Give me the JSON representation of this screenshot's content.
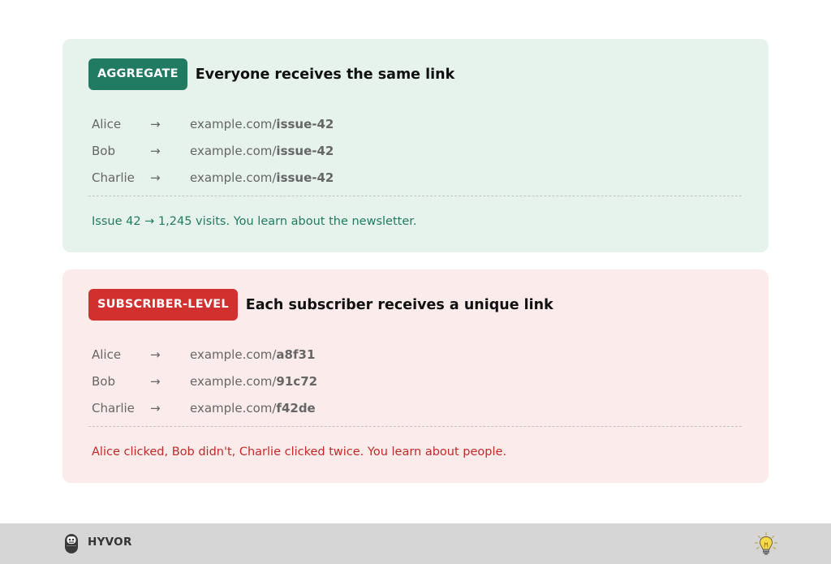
{
  "aggregate": {
    "badge": "AGGREGATE",
    "title": "Everyone receives the same link",
    "rows": [
      {
        "name": "Alice",
        "arrow": "→",
        "url_prefix": "example.com/",
        "url_suffix": "issue-42"
      },
      {
        "name": "Bob",
        "arrow": "→",
        "url_prefix": "example.com/",
        "url_suffix": "issue-42"
      },
      {
        "name": "Charlie",
        "arrow": "→",
        "url_prefix": "example.com/",
        "url_suffix": "issue-42"
      }
    ],
    "note": "Issue 42 → 1,245 visits. You learn about the newsletter."
  },
  "subscriber": {
    "badge": "SUBSCRIBER-LEVEL",
    "title": "Each subscriber receives a unique link",
    "rows": [
      {
        "name": "Alice",
        "arrow": "→",
        "url_prefix": "example.com/",
        "url_suffix": "a8f31"
      },
      {
        "name": "Bob",
        "arrow": "→",
        "url_prefix": "example.com/",
        "url_suffix": "91c72"
      },
      {
        "name": "Charlie",
        "arrow": "→",
        "url_prefix": "example.com/",
        "url_suffix": "f42de"
      }
    ],
    "note": "Alice clicked, Bob didn't, Charlie clicked twice. You learn about people."
  },
  "footer": {
    "brand": "HYVOR",
    "logo_icon": "hyvor-logo-icon",
    "right_icon": "lightbulb-icon"
  },
  "colors": {
    "aggregate_accent": "#217a62",
    "aggregate_bg": "#e6f2ec",
    "subscriber_accent": "#d22f2f",
    "subscriber_bg": "#fbeceb"
  }
}
